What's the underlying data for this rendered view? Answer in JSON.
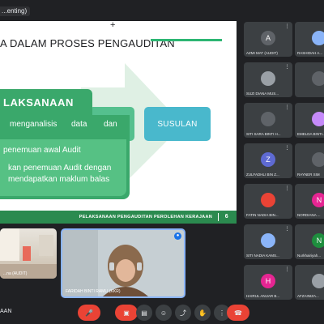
{
  "presenting_label": "...enting)",
  "slide": {
    "title": "A DALAM PROSES PENGAUDITAN",
    "box_title": "LAKSANAAN",
    "body_line1_words": [
      "menganalisis",
      "data",
      "dan"
    ],
    "inner_line1": "penemuan awal Audit",
    "inner_line2": "kan penemuan Audit dengan",
    "inner_line3": "mendapatkan maklum balas",
    "box_susulan": "SUSULAN",
    "footer_text": "PELAKSANAAN PENGAUDITAN PEROLEHAN KERAJAAN",
    "page_number": "6",
    "colors": {
      "green_dark": "#3aa86b",
      "green_light": "#56c184",
      "teal": "#49b8cc",
      "footer": "#2b8a4f"
    }
  },
  "participants": [
    {
      "initial": "A",
      "name": "AZMI MAT (AUDIT)",
      "color": "#5f6368"
    },
    {
      "initial": "",
      "name": "RASHIDAH A...",
      "color": "#8ab4f8"
    },
    {
      "initial": "",
      "name": "SUZI DIANA MUS...",
      "color": "#9aa0a6"
    },
    {
      "initial": "",
      "name": "",
      "color": "#5f6368"
    },
    {
      "initial": "",
      "name": "SITI SARA BINTI H...",
      "color": "#5f6368"
    },
    {
      "initial": "",
      "name": "EMELDA BINTI...",
      "color": "#c58af9"
    },
    {
      "initial": "Z",
      "name": "ZULFADHLI BIN Z...",
      "color": "#5e6ad2"
    },
    {
      "initial": "",
      "name": "RAYNER SIM",
      "color": "#5f6368"
    },
    {
      "initial": "",
      "name": "FATIN NADIA BIN...",
      "color": "#ea4335"
    },
    {
      "initial": "N",
      "name": "NORDIANA ...",
      "color": "#e52592"
    },
    {
      "initial": "",
      "name": "SITI NADIA KAMS...",
      "color": "#8ab4f8"
    },
    {
      "initial": "N",
      "name": "Nurkhairiyah...",
      "color": "#1e8e3e"
    },
    {
      "initial": "H",
      "name": "HAIRUL ANUAR B...",
      "color": "#e52592"
    },
    {
      "initial": "",
      "name": "AFZAINIZA...",
      "color": "#9aa0a6"
    }
  ],
  "video_tiles": [
    {
      "name": "...na (AUDIT)"
    },
    {
      "name": "FARIDAH BINTI RAMLI (KKR)"
    }
  ],
  "bottom": {
    "meeting_label": "AAN",
    "icons": [
      "mic-off-icon",
      "camera-off-icon",
      "captions-icon",
      "emoji-icon",
      "present-icon",
      "raise-hand-icon",
      "more-icon",
      "end-call-icon"
    ]
  }
}
